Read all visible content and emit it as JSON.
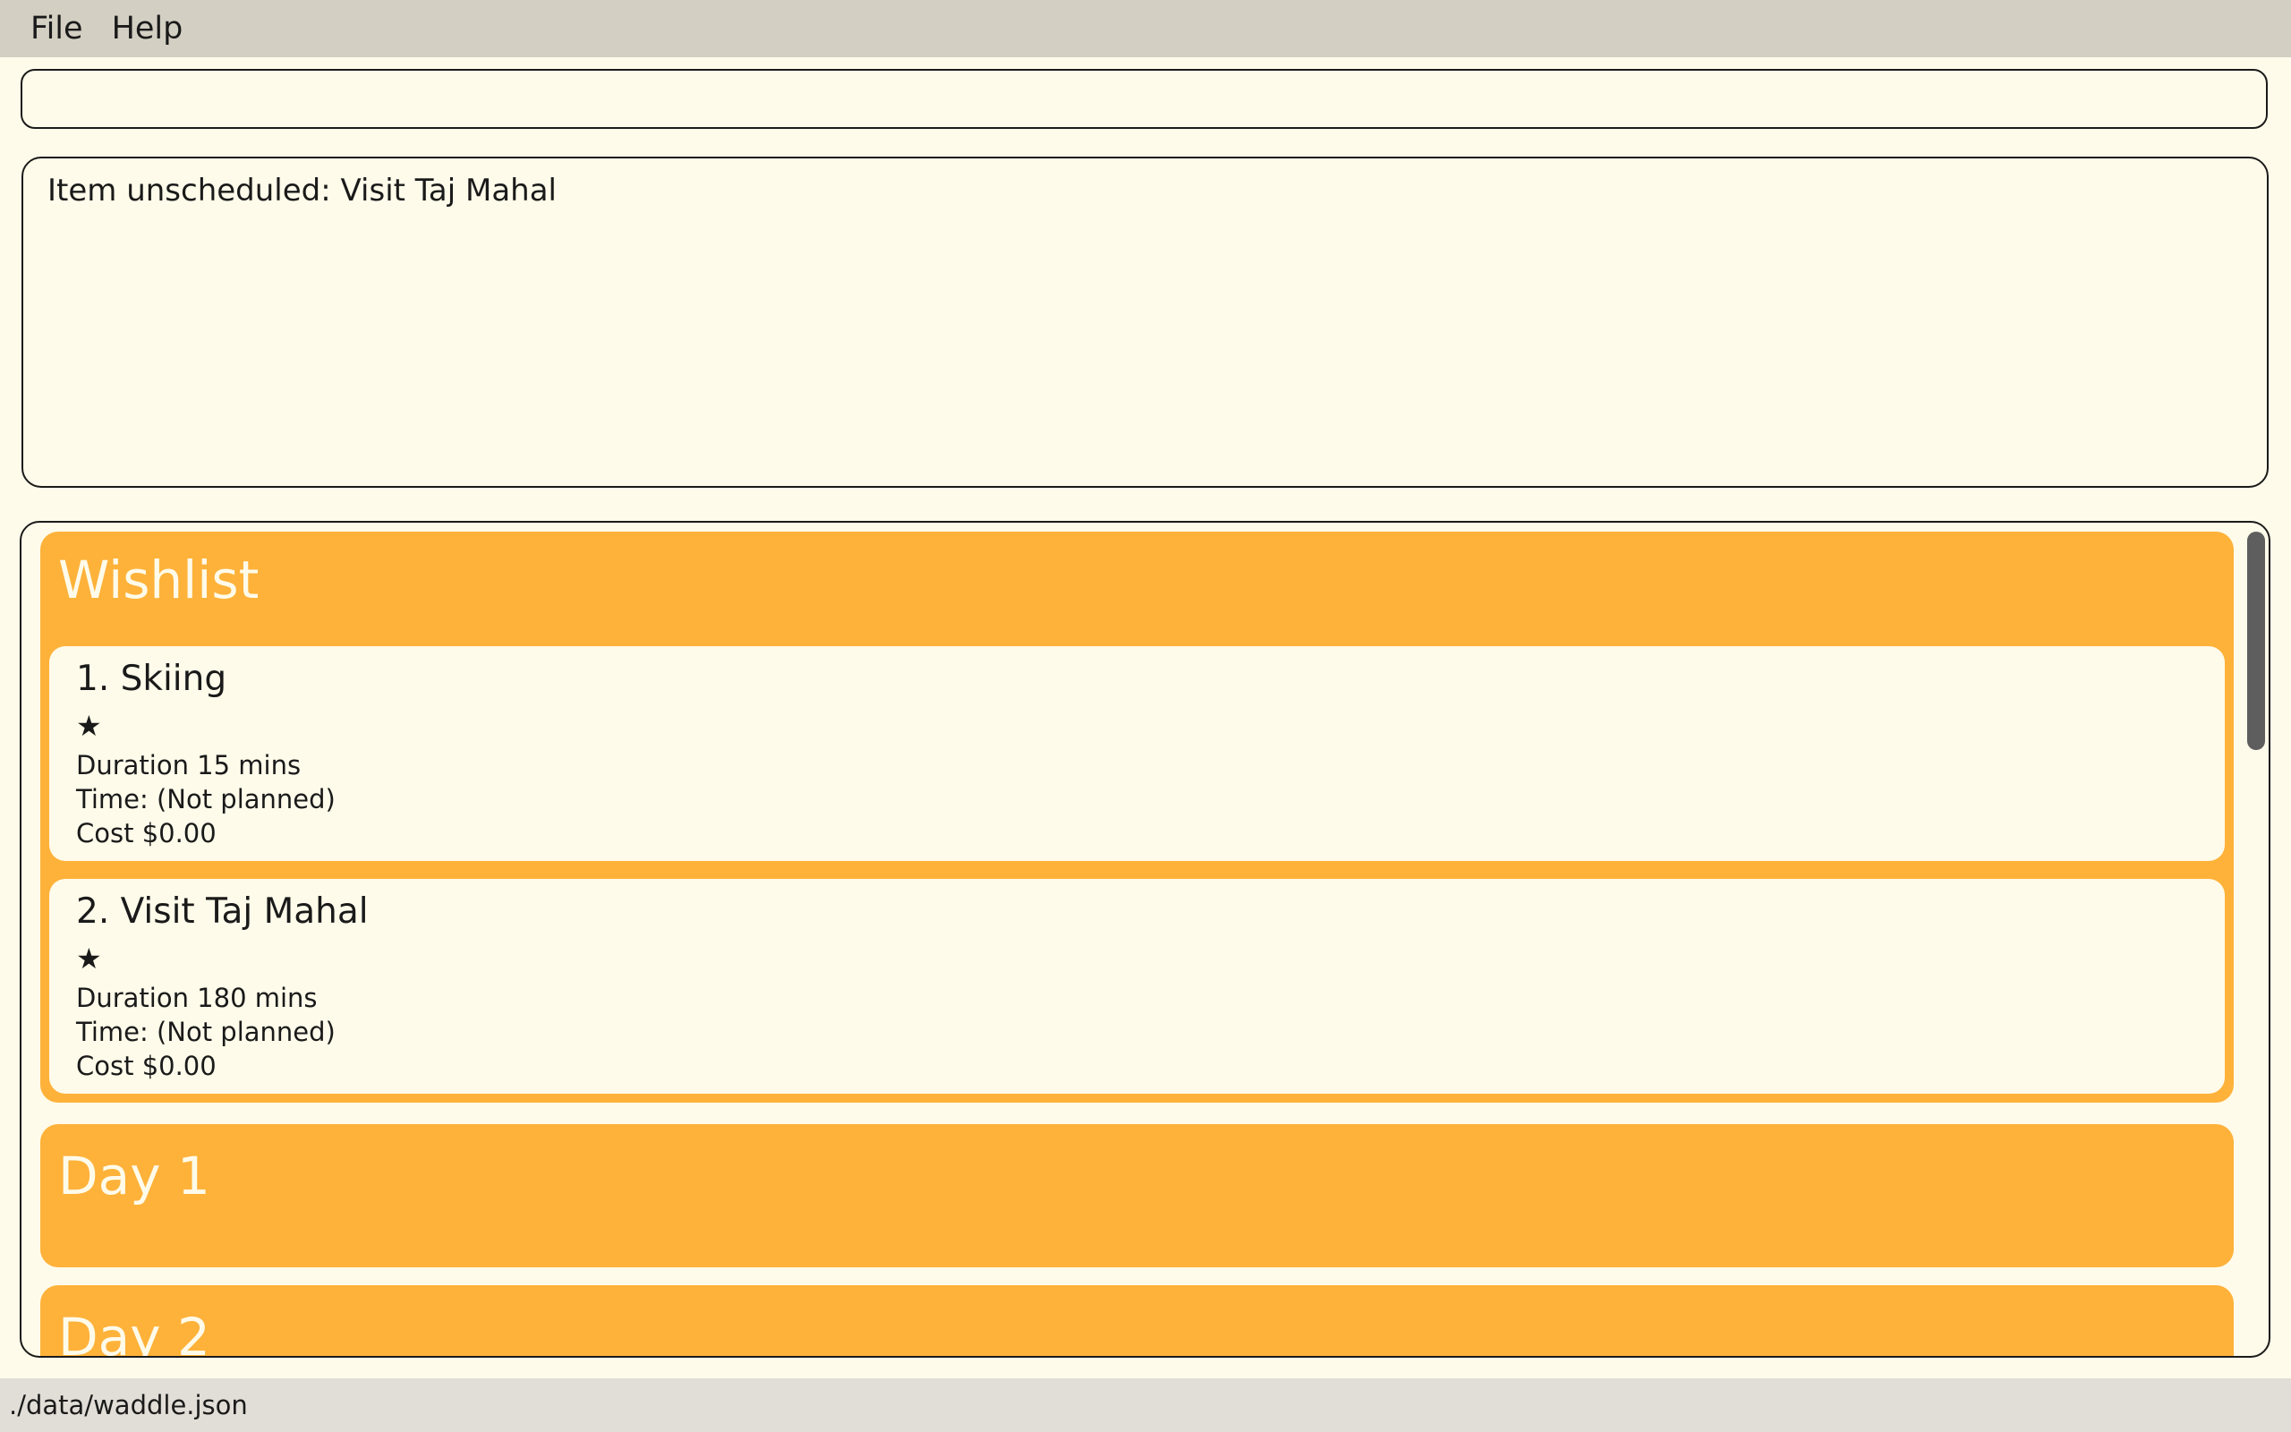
{
  "menu": {
    "file": "File",
    "help": "Help"
  },
  "command": {
    "value": "",
    "placeholder": ""
  },
  "result": {
    "text": "Item unscheduled: Visit Taj Mahal"
  },
  "wishlist": {
    "title": "Wishlist",
    "items": [
      {
        "title": "1.  Skiing",
        "star": "★",
        "duration": "Duration 15 mins",
        "time": "Time: (Not planned)",
        "cost": "Cost $0.00"
      },
      {
        "title": "2.  Visit Taj Mahal",
        "star": "★",
        "duration": "Duration 180 mins",
        "time": "Time: (Not planned)",
        "cost": "Cost $0.00"
      }
    ]
  },
  "days": [
    {
      "title": "Day 1"
    },
    {
      "title": "Day 2"
    }
  ],
  "status": {
    "path": "./data/waddle.json"
  },
  "colors": {
    "accent": "#feb23a",
    "background": "#fffbea",
    "menubar": "#d3cfc3",
    "statusbar": "#e0ded6"
  }
}
